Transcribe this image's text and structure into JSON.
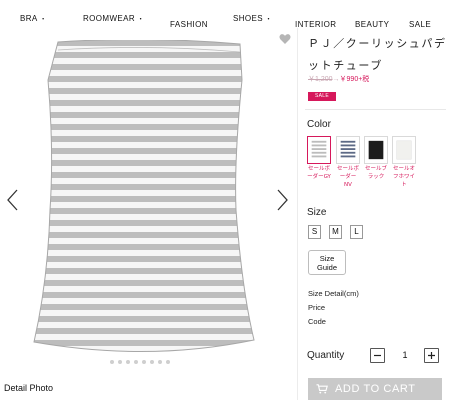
{
  "nav": {
    "items": [
      {
        "label": "BRA",
        "dot": "・"
      },
      {
        "label": "ROOMWEAR",
        "dot": "・"
      },
      {
        "label": "FASHION",
        "dot": ""
      },
      {
        "label": "SHOES",
        "dot": "・"
      },
      {
        "label": "INTERIOR",
        "dot": ""
      },
      {
        "label": "BEAUTY",
        "dot": ""
      },
      {
        "label": "SALE",
        "dot": ""
      }
    ]
  },
  "gallery": {
    "detail_label": "Detail Photo",
    "stripe_colors": [
      "#b8b8b8",
      "#f6f6f6"
    ]
  },
  "product": {
    "title": "ＰＪ／クーリッシュパデットチューブ",
    "price_old": "￥1,200",
    "price_arrow": "→",
    "price_new": "￥990",
    "price_tax": "+税",
    "sale_badge": "SALE",
    "colors_heading": "Color",
    "colors": [
      {
        "label": "セールボーダーGY",
        "swatch": "#bcbcbc",
        "selected": true
      },
      {
        "label": "セールボーダーNV",
        "swatch": "#5d6a86",
        "selected": false
      },
      {
        "label": "セールブラック",
        "swatch": "#1c1c1c",
        "selected": false
      },
      {
        "label": "セールオフホワイト",
        "swatch": "#f1f1ee",
        "selected": false
      }
    ],
    "size_heading": "Size",
    "sizes": [
      "S",
      "M",
      "L"
    ],
    "size_guide": "Size\nGuide",
    "specs": [
      "Size Detail(cm)",
      "Price",
      "Code"
    ],
    "quantity_label": "Quantity",
    "quantity_value": "1",
    "add_to_cart": "ADD TO CART"
  },
  "colors": {
    "accent": "#d6185b",
    "cart_button": "#c9c9c9"
  },
  "icons": [
    "heart-icon",
    "chevron-left-icon",
    "chevron-right-icon",
    "minus-icon",
    "plus-icon",
    "cart-icon"
  ]
}
